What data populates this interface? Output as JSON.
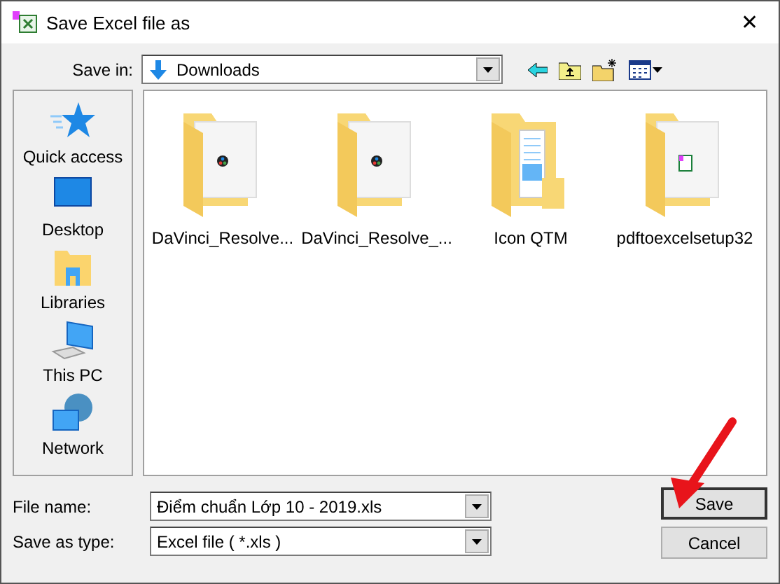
{
  "window": {
    "title": "Save Excel file as",
    "close": "✕"
  },
  "save_in": {
    "label": "Save in:",
    "value": "Downloads"
  },
  "places": [
    {
      "label": "Quick access",
      "kind": "star"
    },
    {
      "label": "Desktop",
      "kind": "desktop"
    },
    {
      "label": "Libraries",
      "kind": "library"
    },
    {
      "label": "This PC",
      "kind": "pc"
    },
    {
      "label": "Network",
      "kind": "network"
    }
  ],
  "files": [
    {
      "name": "DaVinci_Resolve...",
      "kind": "app"
    },
    {
      "name": "DaVinci_Resolve_...",
      "kind": "app"
    },
    {
      "name": "Icon QTM",
      "kind": "docs"
    },
    {
      "name": "pdftoexcelsetup32",
      "kind": "excel"
    }
  ],
  "file_name": {
    "label": "File name:",
    "value": "Điểm chuẩn Lớp 10 - 2019.xls"
  },
  "save_as_type": {
    "label": "Save as type:",
    "value": "Excel file ( *.xls )"
  },
  "buttons": [
    {
      "label": "Save",
      "kind": "primary"
    },
    {
      "label": "Cancel",
      "kind": "normal"
    }
  ]
}
